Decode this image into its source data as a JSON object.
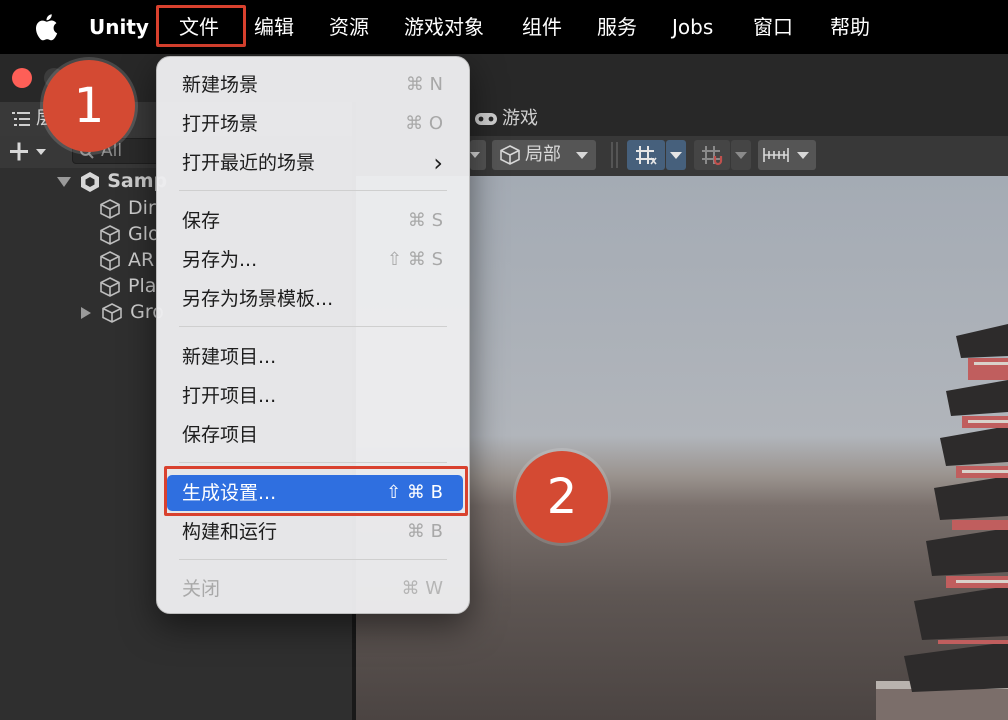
{
  "menubar": {
    "app_name": "Unity",
    "items": [
      "文件",
      "编辑",
      "资源",
      "游戏对象",
      "组件",
      "服务",
      "Jobs",
      "窗口",
      "帮助"
    ]
  },
  "hierarchy": {
    "tab_label": "层",
    "search_placeholder": "All",
    "scene_name": "Samp",
    "objects": [
      "Dir",
      "Glo",
      "AR",
      "Pla",
      "Gro"
    ]
  },
  "scene": {
    "game_tab_label": "游戏",
    "local_button_label": "局部"
  },
  "file_menu": {
    "items": [
      {
        "label": "新建场景",
        "shortcut": "⌘ N"
      },
      {
        "label": "打开场景",
        "shortcut": "⌘ O"
      },
      {
        "label": "打开最近的场景",
        "submenu_arrow": "›"
      },
      {
        "label": "保存",
        "shortcut": "⌘ S"
      },
      {
        "label": "另存为...",
        "shortcut": "⇧ ⌘ S"
      },
      {
        "label": "另存为场景模板..."
      },
      {
        "label": "新建项目..."
      },
      {
        "label": "打开项目..."
      },
      {
        "label": "保存项目"
      },
      {
        "label": "生成设置...",
        "shortcut": "⇧ ⌘ B",
        "selected": true
      },
      {
        "label": "构建和运行",
        "shortcut": "⌘ B"
      },
      {
        "label": "关闭",
        "shortcut": "⌘ W",
        "disabled": true
      }
    ]
  },
  "annotations": {
    "step1": "1",
    "step2": "2",
    "highlight_color": "#d9412e"
  },
  "colors": {
    "selection": "#2f6fe0",
    "close_button": "#fe5f57"
  }
}
